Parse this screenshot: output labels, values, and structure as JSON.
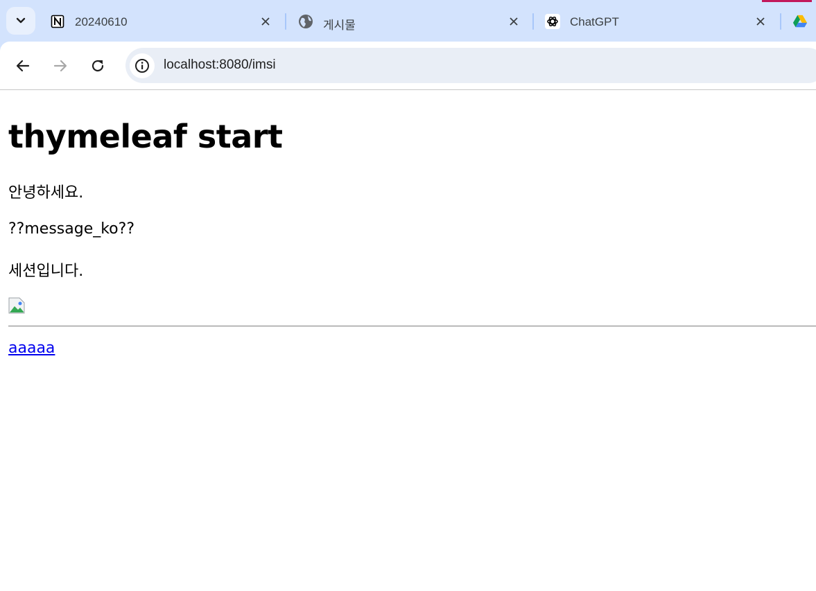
{
  "browser": {
    "tabs": [
      {
        "title": "20240610",
        "favicon": "notion-icon",
        "active": false
      },
      {
        "title": "게시물",
        "favicon": "globe-icon",
        "active": false
      },
      {
        "title": "ChatGPT",
        "favicon": "openai-icon",
        "active": false
      }
    ],
    "extra_tab_favicon": "google-drive-icon",
    "url": "localhost:8080/imsi",
    "accent_color": "#d3e3fd"
  },
  "page": {
    "title": "thymeleaf start",
    "greeting": "안녕하세요.",
    "missing_message": "??message_ko??",
    "session_text": "세션입니다.",
    "link_text": "aaaaa"
  }
}
